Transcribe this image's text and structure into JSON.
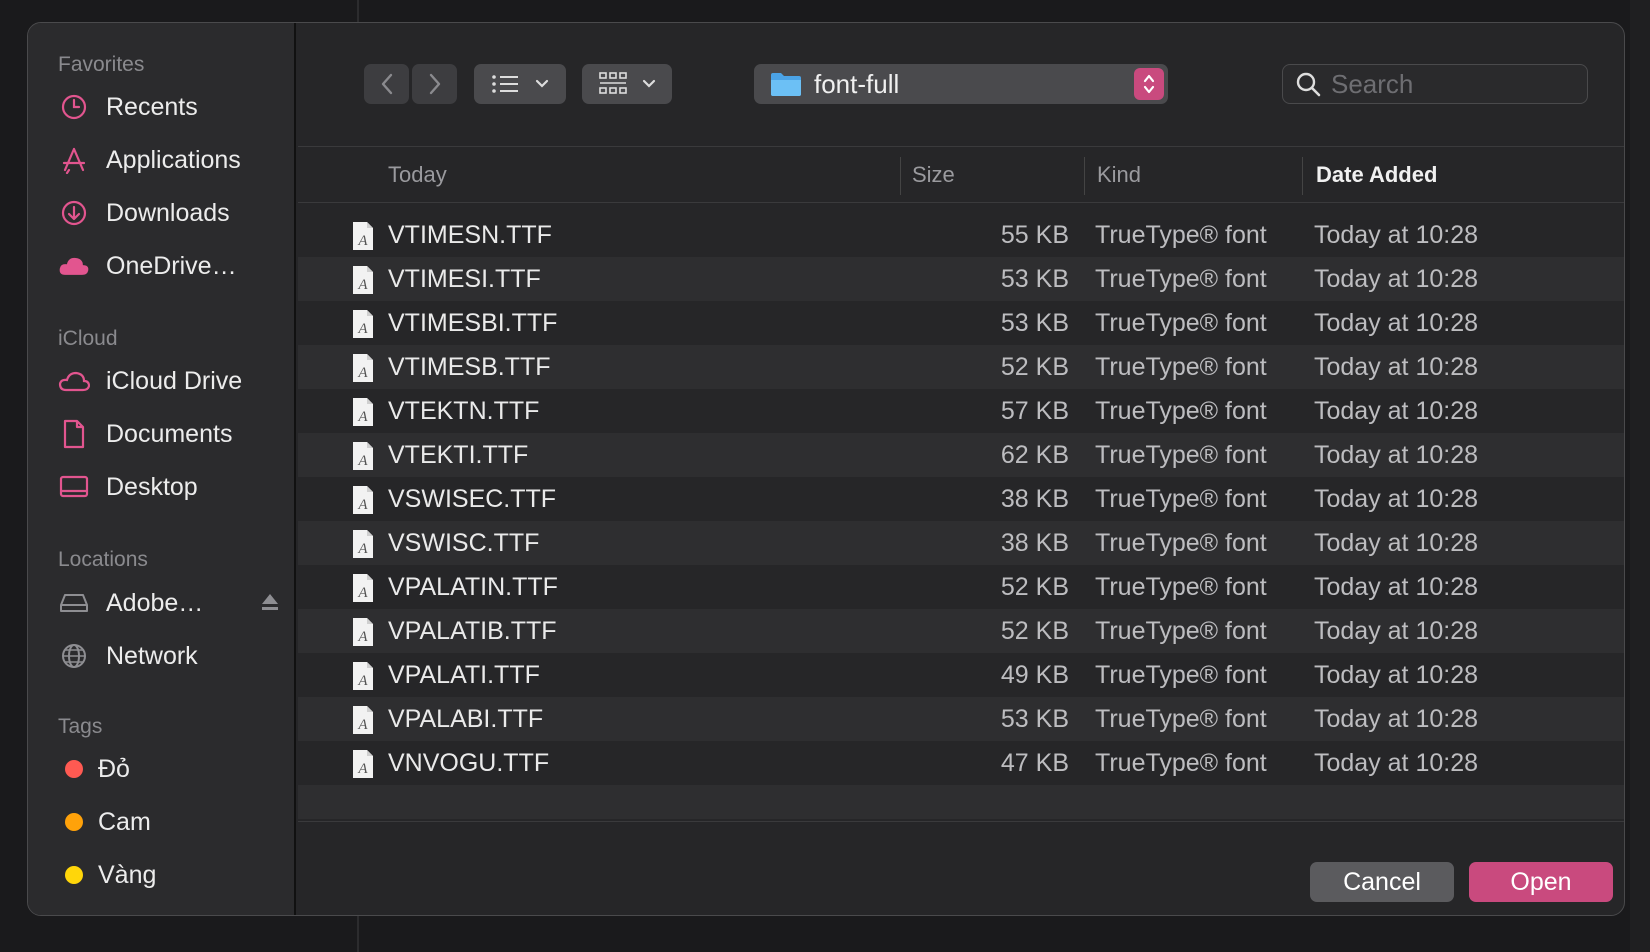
{
  "sidebar": {
    "sections": [
      {
        "title": "Favorites"
      },
      {
        "title": "iCloud"
      },
      {
        "title": "Locations"
      },
      {
        "title": "Tags"
      }
    ],
    "favorites": [
      {
        "label": "Recents",
        "icon": "clock-icon"
      },
      {
        "label": "Applications",
        "icon": "applications-icon"
      },
      {
        "label": "Downloads",
        "icon": "download-icon"
      },
      {
        "label": "OneDrive…",
        "icon": "cloud-icon"
      }
    ],
    "icloud": [
      {
        "label": "iCloud Drive",
        "icon": "icloud-icon"
      },
      {
        "label": "Documents",
        "icon": "document-icon"
      },
      {
        "label": "Desktop",
        "icon": "desktop-icon"
      }
    ],
    "locations": [
      {
        "label": "Adobe…",
        "icon": "drive-icon"
      },
      {
        "label": "Network",
        "icon": "globe-icon"
      }
    ],
    "tags": [
      {
        "label": "Đỏ",
        "color": "#ff5a52"
      },
      {
        "label": "Cam",
        "color": "#ffa20a"
      },
      {
        "label": "Vàng",
        "color": "#ffd60a"
      }
    ]
  },
  "toolbar": {
    "back_icon": "chevron-left-icon",
    "forward_icon": "chevron-right-icon",
    "list_view_icon": "list-icon",
    "grid_view_icon": "grid-icon",
    "folder_name": "font-full",
    "folder_icon": "folder-icon",
    "search_placeholder": "Search"
  },
  "columns": {
    "name": "Today",
    "size": "Size",
    "kind": "Kind",
    "date": "Date Added"
  },
  "files": [
    {
      "name": "VTIMESN.TTF",
      "size": "55 KB",
      "kind": "TrueType® font",
      "date": "Today at 10:28"
    },
    {
      "name": "VTIMESI.TTF",
      "size": "53 KB",
      "kind": "TrueType® font",
      "date": "Today at 10:28"
    },
    {
      "name": "VTIMESBI.TTF",
      "size": "53 KB",
      "kind": "TrueType® font",
      "date": "Today at 10:28"
    },
    {
      "name": "VTIMESB.TTF",
      "size": "52 KB",
      "kind": "TrueType® font",
      "date": "Today at 10:28"
    },
    {
      "name": "VTEKTN.TTF",
      "size": "57 KB",
      "kind": "TrueType® font",
      "date": "Today at 10:28"
    },
    {
      "name": "VTEKTI.TTF",
      "size": "62 KB",
      "kind": "TrueType® font",
      "date": "Today at 10:28"
    },
    {
      "name": "VSWISEC.TTF",
      "size": "38 KB",
      "kind": "TrueType® font",
      "date": "Today at 10:28"
    },
    {
      "name": "VSWISC.TTF",
      "size": "38 KB",
      "kind": "TrueType® font",
      "date": "Today at 10:28"
    },
    {
      "name": "VPALATIN.TTF",
      "size": "52 KB",
      "kind": "TrueType® font",
      "date": "Today at 10:28"
    },
    {
      "name": "VPALATIB.TTF",
      "size": "52 KB",
      "kind": "TrueType® font",
      "date": "Today at 10:28"
    },
    {
      "name": "VPALATI.TTF",
      "size": "49 KB",
      "kind": "TrueType® font",
      "date": "Today at 10:28"
    },
    {
      "name": "VPALABI.TTF",
      "size": "53 KB",
      "kind": "TrueType® font",
      "date": "Today at 10:28"
    },
    {
      "name": "VNVOGU.TTF",
      "size": "47 KB",
      "kind": "TrueType® font",
      "date": "Today at 10:28"
    }
  ],
  "buttons": {
    "cancel": "Cancel",
    "open": "Open"
  },
  "colors": {
    "accent": "#c94a7e",
    "sidebar_icon": "#e2558f"
  }
}
